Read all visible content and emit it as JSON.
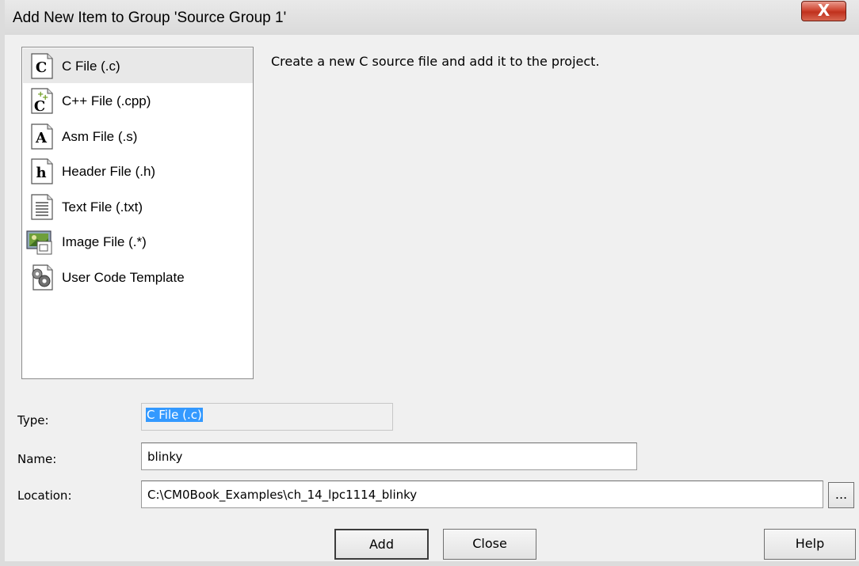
{
  "window": {
    "title": "Add New Item to Group 'Source Group 1'",
    "close_label": "X"
  },
  "file_types": [
    {
      "label": "C File (.c)",
      "icon": "c-file-icon",
      "glyph": "C",
      "selected": true
    },
    {
      "label": "C++ File (.cpp)",
      "icon": "cpp-file-icon",
      "glyph": "C",
      "selected": false
    },
    {
      "label": "Asm File (.s)",
      "icon": "asm-file-icon",
      "glyph": "A",
      "selected": false
    },
    {
      "label": "Header File (.h)",
      "icon": "header-file-icon",
      "glyph": "h",
      "selected": false
    },
    {
      "label": "Text File (.txt)",
      "icon": "text-file-icon",
      "glyph": "",
      "selected": false
    },
    {
      "label": "Image File (.*)",
      "icon": "image-file-icon",
      "glyph": "",
      "selected": false
    },
    {
      "label": "User Code Template",
      "icon": "user-code-template-icon",
      "glyph": "",
      "selected": false
    }
  ],
  "description": "Create a new C source file and add it to the project.",
  "form": {
    "type_label": "Type:",
    "type_value": "C File (.c)",
    "name_label": "Name:",
    "name_value": "blinky",
    "location_label": "Location:",
    "location_value": "C:\\CM0Book_Examples\\ch_14_lpc1114_blinky",
    "browse_label": "..."
  },
  "buttons": {
    "add": "Add",
    "close": "Close",
    "help": "Help"
  },
  "colors": {
    "selection": "#3399ff",
    "close_button": "#c9432f",
    "dialog_bg": "#f0f0f0"
  }
}
